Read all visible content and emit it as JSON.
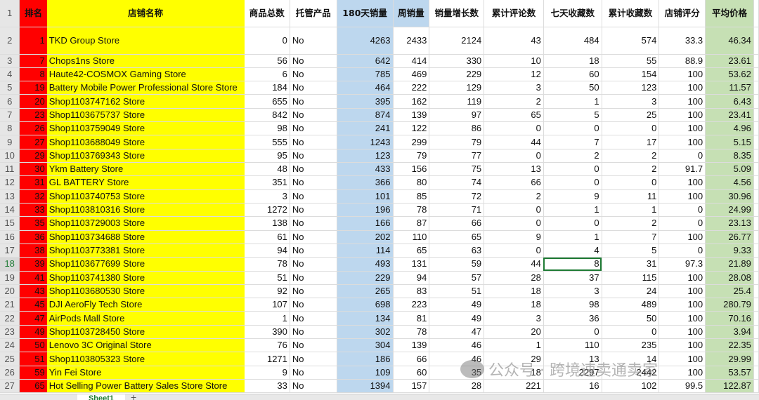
{
  "columns": [
    "排名",
    "店铺名称",
    "商品总数",
    "托管产品",
    "180天销量",
    "周销量",
    "销量增长数",
    "累计评论数",
    "七天收藏数",
    "累计收藏数",
    "店铺评分",
    "平均价格"
  ],
  "rows": [
    [
      "1",
      "TKD Group Store",
      "0",
      "No",
      "4263",
      "2433",
      "2124",
      "43",
      "484",
      "574",
      "33.3",
      "46.34"
    ],
    [
      "7",
      "Chops1ns Store",
      "56",
      "No",
      "642",
      "414",
      "330",
      "10",
      "18",
      "55",
      "88.9",
      "23.61"
    ],
    [
      "8",
      "Haute42-COSMOX Gaming Store",
      "6",
      "No",
      "785",
      "469",
      "229",
      "12",
      "60",
      "154",
      "100",
      "53.62"
    ],
    [
      "19",
      "Battery Mobile Power Professional Store Store",
      "184",
      "No",
      "464",
      "222",
      "129",
      "3",
      "50",
      "123",
      "100",
      "11.57"
    ],
    [
      "20",
      "Shop1103747162 Store",
      "655",
      "No",
      "395",
      "162",
      "119",
      "2",
      "1",
      "3",
      "100",
      "6.43"
    ],
    [
      "23",
      "Shop1103675737 Store",
      "842",
      "No",
      "874",
      "139",
      "97",
      "65",
      "5",
      "25",
      "100",
      "23.41"
    ],
    [
      "26",
      "Shop1103759049 Store",
      "98",
      "No",
      "241",
      "122",
      "86",
      "0",
      "0",
      "0",
      "100",
      "4.96"
    ],
    [
      "27",
      "Shop1103688049 Store",
      "555",
      "No",
      "1243",
      "299",
      "79",
      "44",
      "7",
      "17",
      "100",
      "5.15"
    ],
    [
      "29",
      "Shop1103769343 Store",
      "95",
      "No",
      "123",
      "79",
      "77",
      "0",
      "2",
      "2",
      "0",
      "8.35"
    ],
    [
      "30",
      "Ykm Battery Store",
      "48",
      "No",
      "433",
      "156",
      "75",
      "13",
      "0",
      "2",
      "91.7",
      "5.09"
    ],
    [
      "31",
      "GL BATTERY Store",
      "351",
      "No",
      "366",
      "80",
      "74",
      "66",
      "0",
      "0",
      "100",
      "4.56"
    ],
    [
      "32",
      "Shop1103740753 Store",
      "3",
      "No",
      "101",
      "85",
      "72",
      "2",
      "9",
      "11",
      "100",
      "30.96"
    ],
    [
      "33",
      "Shop1103810316 Store",
      "1272",
      "No",
      "196",
      "78",
      "71",
      "0",
      "1",
      "1",
      "0",
      "24.99"
    ],
    [
      "35",
      "Shop1103729003 Store",
      "138",
      "No",
      "166",
      "87",
      "66",
      "0",
      "0",
      "2",
      "0",
      "23.13"
    ],
    [
      "36",
      "Shop1103734688 Store",
      "61",
      "No",
      "202",
      "110",
      "65",
      "9",
      "1",
      "7",
      "100",
      "26.77"
    ],
    [
      "38",
      "Shop1103773381 Store",
      "94",
      "No",
      "114",
      "65",
      "63",
      "0",
      "4",
      "5",
      "0",
      "9.33"
    ],
    [
      "39",
      "Shop1103677699 Store",
      "78",
      "No",
      "493",
      "131",
      "59",
      "44",
      "8",
      "31",
      "97.3",
      "21.89"
    ],
    [
      "41",
      "Shop1103741380 Store",
      "51",
      "No",
      "229",
      "94",
      "57",
      "28",
      "37",
      "115",
      "100",
      "28.08"
    ],
    [
      "43",
      "Shop1103680530 Store",
      "92",
      "No",
      "265",
      "83",
      "51",
      "18",
      "3",
      "24",
      "100",
      "25.4"
    ],
    [
      "45",
      "DJI AeroFly Tech Store",
      "107",
      "No",
      "698",
      "223",
      "49",
      "18",
      "98",
      "489",
      "100",
      "280.79"
    ],
    [
      "47",
      "AirPods Mall Store",
      "1",
      "No",
      "134",
      "81",
      "49",
      "3",
      "36",
      "50",
      "100",
      "70.16"
    ],
    [
      "49",
      "Shop1103728450 Store",
      "390",
      "No",
      "302",
      "78",
      "47",
      "20",
      "0",
      "0",
      "100",
      "3.94"
    ],
    [
      "50",
      "Lenovo 3C Original Store",
      "76",
      "No",
      "304",
      "139",
      "46",
      "1",
      "110",
      "235",
      "100",
      "22.35"
    ],
    [
      "51",
      "Shop1103805323 Store",
      "1271",
      "No",
      "186",
      "66",
      "46",
      "29",
      "13",
      "14",
      "100",
      "29.99"
    ],
    [
      "59",
      "Yin Fei Store",
      "9",
      "No",
      "109",
      "60",
      "35",
      "18",
      "2297",
      "2442",
      "100",
      "53.57"
    ],
    [
      "65",
      "Hot Selling Power Battery Sales Store Store",
      "33",
      "No",
      "1394",
      "157",
      "28",
      "221",
      "16",
      "102",
      "99.5",
      "122.87"
    ]
  ],
  "selected_cell": {
    "row": 18,
    "column": "七天收藏数"
  },
  "sheet_tab": "Sheet1",
  "add_sheet": "+",
  "watermark": "公众号 · 跨境速卖通卖家",
  "colors": {
    "rank": "#ff0000",
    "name": "#ffff00",
    "sales180": "#bdd7ee",
    "avg_price": "#c6e0b4",
    "selection": "#1e7b34"
  }
}
